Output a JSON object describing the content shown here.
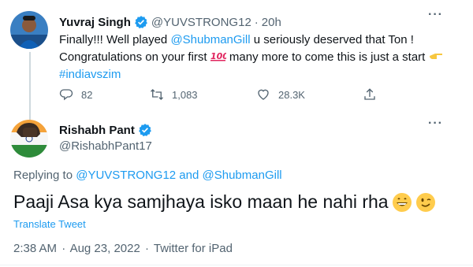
{
  "tweet1": {
    "name": "Yuvraj Singh",
    "handle": "@YUVSTRONG12",
    "separator": "·",
    "age": "20h",
    "text_1": "Finally!!!  Well played ",
    "mention": "@ShubmanGill",
    "text_2": " u seriously deserved that Ton !",
    "text_3": "Congratulations on your first ",
    "text_4": " many more to come this is just a start ",
    "hashtag": "#indiavszim",
    "replies": "82",
    "retweets": "1,083",
    "likes": "28.3K",
    "icons": [
      "verified-icon",
      "hundred-points-icon",
      "backhand-pointing-icon",
      "reply-icon",
      "retweet-icon",
      "like-icon",
      "share-icon",
      "more-icon"
    ]
  },
  "tweet2": {
    "name": "Rishabh Pant",
    "handle": "@RishabhPant17",
    "replying_to_label": "Replying to ",
    "replying_to_1": "@YUVSTRONG12",
    "replying_and": " and ",
    "replying_to_2": "@ShubmanGill",
    "text": "Paaji Asa kya samjhaya isko maan he nahi rha",
    "translate": "Translate Tweet",
    "time": "2:38 AM",
    "date": "Aug 23, 2022",
    "source": "Twitter for iPad",
    "separator": "·",
    "icons": [
      "verified-icon",
      "grinning-face-icon",
      "winking-face-icon",
      "more-icon"
    ]
  },
  "more_label": "···",
  "colors": {
    "text": "#0f1419",
    "secondary": "#536471",
    "accent": "#1d9bf0",
    "thread_line": "#cfd9de"
  }
}
